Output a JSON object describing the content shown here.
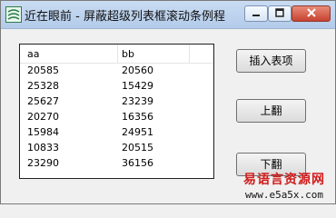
{
  "window": {
    "title": "近在眼前 - 屏蔽超级列表框滚动条例程"
  },
  "list": {
    "columns": [
      "aa",
      "bb"
    ],
    "rows": [
      [
        "20585",
        "20560"
      ],
      [
        "25328",
        "15429"
      ],
      [
        "25627",
        "23239"
      ],
      [
        "20270",
        "16356"
      ],
      [
        "15984",
        "24951"
      ],
      [
        "10833",
        "20515"
      ],
      [
        "23290",
        "36156"
      ]
    ]
  },
  "buttons": {
    "insert": "插入表项",
    "up": "上翻",
    "down": "下翻"
  },
  "watermark": {
    "site_cn": "易语言资源网",
    "url": "www.e5a5x.com"
  }
}
